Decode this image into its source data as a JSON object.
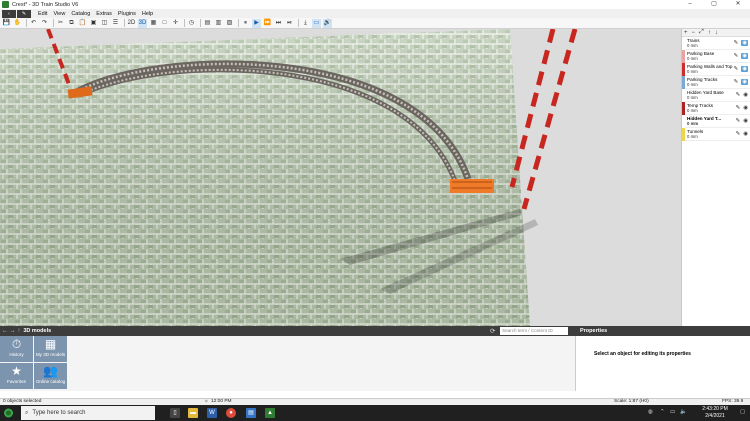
{
  "window": {
    "title": "Crest* - 3D Train Studio V6",
    "controls": [
      "–",
      "▢",
      "✕"
    ]
  },
  "menu": {
    "nav_back": "‹",
    "nav_edit": "✎",
    "items": [
      "Edit",
      "View",
      "Catalog",
      "Extras",
      "Plugins",
      "Help"
    ]
  },
  "toolbar": {
    "view_2d_label": "2D",
    "view_3d_label": "3D"
  },
  "layers": {
    "toolbar_icons": [
      "+",
      "−",
      "⤢",
      "↑",
      "↓"
    ],
    "items": [
      {
        "name": "Trains",
        "size": "0 mm",
        "color": "#ffffff",
        "visible": true
      },
      {
        "name": "Parking Base",
        "size": "0 mm",
        "color": "#e9a3a3",
        "visible": true
      },
      {
        "name": "Parking Walls and Top",
        "size": "0 mm",
        "color": "#d22b2b",
        "visible": true
      },
      {
        "name": "Parking Tracks",
        "size": "0 mm",
        "color": "#7aa9d6",
        "visible": true
      },
      {
        "name": "Hidden Yard Base",
        "size": "0 mm",
        "color": "#ffffff",
        "visible": false
      },
      {
        "name": "Temp Tracks",
        "size": "0 mm",
        "color": "#b02323",
        "visible": false
      },
      {
        "name": "Hidden Yard T...",
        "size": "0 mm",
        "color": "#ffffff",
        "visible": false,
        "bold": true
      },
      {
        "name": "Tunnels",
        "size": "0 mm",
        "color": "#e8d84a",
        "visible": false
      }
    ]
  },
  "catalog": {
    "title": "3D models",
    "search_placeholder": "Search term / Content ID",
    "tiles": [
      {
        "label": "History",
        "icon": "⏱"
      },
      {
        "label": "My 3D models",
        "icon": "▦"
      },
      {
        "label": "Favorites",
        "icon": "★"
      },
      {
        "label": "Online catalog",
        "icon": "👥"
      }
    ]
  },
  "properties": {
    "title": "Properties",
    "message": "Select an object for editing its properties"
  },
  "status": {
    "selection": "0 objects selected",
    "time": "12:00 PM",
    "scale": "Scale: 1:87 (H0)",
    "fps": "FPS: 39.9"
  },
  "taskbar": {
    "search_placeholder": "Type here to search",
    "clock_time": "2:43:20 PM",
    "clock_date": "2/4/2021"
  }
}
